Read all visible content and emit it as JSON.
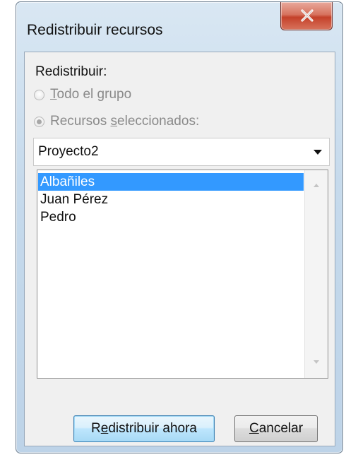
{
  "window": {
    "title": "Redistribuir recursos",
    "close_icon": "close-icon"
  },
  "form": {
    "section_label": "Redistribuir:",
    "radio_all": {
      "label_accel": "T",
      "label_rest": "odo el grupo",
      "checked": false,
      "enabled": false
    },
    "radio_selected": {
      "label_pre": "Recursos ",
      "label_accel": "s",
      "label_rest": "eleccionados:",
      "checked": true,
      "enabled": false
    },
    "project_select": {
      "value": "Proyecto2"
    },
    "resources": [
      {
        "name": "Albañiles",
        "selected": true
      },
      {
        "name": "Juan Pérez",
        "selected": false
      },
      {
        "name": "Pedro",
        "selected": false
      }
    ]
  },
  "buttons": {
    "level_now": {
      "pre": "R",
      "accel": "e",
      "rest": "distribuir ahora"
    },
    "cancel": {
      "accel": "C",
      "rest": "ancelar"
    }
  },
  "colors": {
    "selection": "#3399ff",
    "close_button": "#c4412a",
    "frame": "#c6daec"
  }
}
